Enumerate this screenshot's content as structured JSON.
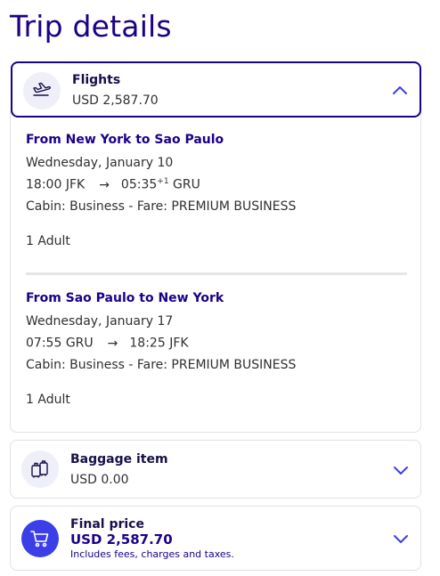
{
  "page": {
    "title": "Trip details"
  },
  "flights": {
    "label": "Flights",
    "price": "USD 2,587.70",
    "segments": [
      {
        "title": "From New York to Sao Paulo",
        "date": "Wednesday, January 10",
        "depart_time": "18:00",
        "depart_code": "JFK",
        "arrive_time": "05:35",
        "arrive_offset": "+1",
        "arrive_code": "GRU",
        "cabin": "Cabin: Business - Fare: PREMIUM BUSINESS",
        "passengers": "1 Adult"
      },
      {
        "title": "From Sao Paulo to New York",
        "date": "Wednesday, January 17",
        "depart_time": "07:55",
        "depart_code": "GRU",
        "arrive_time": "18:25",
        "arrive_offset": "",
        "arrive_code": "JFK",
        "cabin": "Cabin: Business - Fare: PREMIUM BUSINESS",
        "passengers": "1 Adult"
      }
    ],
    "icon": "plane-takeoff-icon"
  },
  "baggage": {
    "label": "Baggage item",
    "price": "USD 0.00",
    "icon": "luggage-icon"
  },
  "final_price": {
    "label": "Final price",
    "price": "USD 2,587.70",
    "note": "Includes fees, charges and taxes.",
    "icon": "shopping-cart-icon"
  },
  "colors": {
    "brand": "#1b0088",
    "accent": "#3c3ee8",
    "icon_bg": "#efeff9"
  }
}
